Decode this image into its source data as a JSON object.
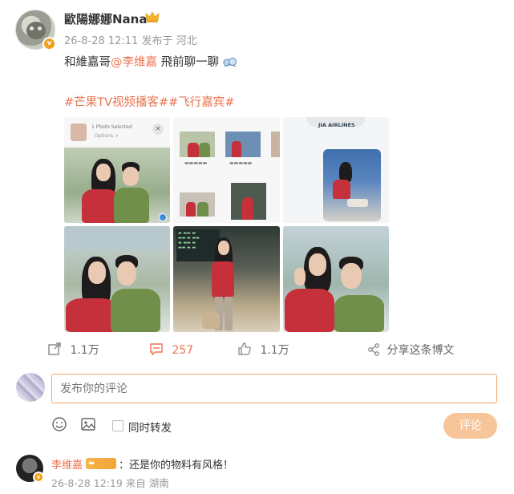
{
  "post": {
    "author": "歐陽娜娜Nana",
    "meta": "26-8-28 12:11 发布于 河北",
    "text_before": "和維嘉哥",
    "mention": "@李维嘉",
    "text_after": " 飛前聊一聊 ",
    "topics": "#芒果TV视频播客##飞行嘉宾#",
    "images": {
      "p1_header": "1 Photo Selected",
      "p1_sub": "Options >",
      "p3_title": "JIA AIRLINES"
    }
  },
  "actions": {
    "repost_count": "1.1万",
    "comment_count": "257",
    "like_count": "1.1万",
    "share_label": "分享这条博文"
  },
  "comment_box": {
    "placeholder": "发布你的评论",
    "repost_label": "同时转发",
    "submit_label": "评论"
  },
  "reply": {
    "name": "李维嘉",
    "separator": "：",
    "text": "还是你的物料有风格！",
    "meta": "26-8-28 12:19 来自 湖南"
  },
  "colors": {
    "accent": "#eb7350",
    "input_border": "#f3a76d",
    "submit_bg": "#f7c59a",
    "muted": "#999999"
  },
  "icons": [
    "crown-icon",
    "verified-badge-icon",
    "repost-icon",
    "comment-icon",
    "like-icon",
    "share-icon",
    "emoji-icon",
    "image-icon",
    "close-icon"
  ]
}
